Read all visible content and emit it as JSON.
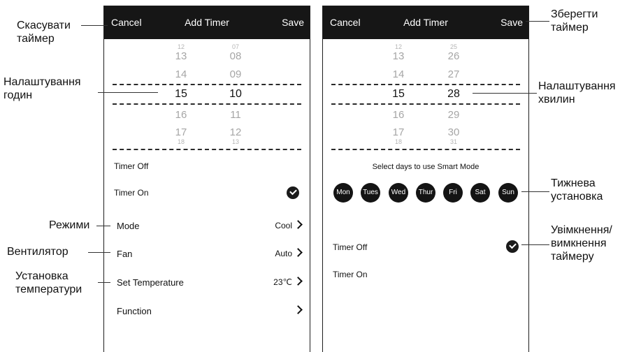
{
  "left_screen": {
    "header": {
      "cancel": "Cancel",
      "title": "Add Timer",
      "save": "Save"
    },
    "hour_col": {
      "tiny_top": "12",
      "above2": "13",
      "above1": "14",
      "selected": "15",
      "below1": "16",
      "below2": "17",
      "tiny_bottom": "18"
    },
    "minute_col": {
      "tiny_top": "07",
      "above2": "08",
      "above1": "09",
      "selected": "10",
      "below1": "11",
      "below2": "12",
      "tiny_bottom": "13"
    },
    "timer_off": "Timer Off",
    "timer_on": "Timer On",
    "settings": [
      {
        "label": "Mode",
        "value": "Cool"
      },
      {
        "label": "Fan",
        "value": "Auto"
      },
      {
        "label": "Set Temperature",
        "value": "23℃"
      },
      {
        "label": "Function",
        "value": ""
      }
    ]
  },
  "right_screen": {
    "header": {
      "cancel": "Cancel",
      "title": "Add Timer",
      "save": "Save"
    },
    "hour_col": {
      "tiny_top": "12",
      "above2": "13",
      "above1": "14",
      "selected": "15",
      "below1": "16",
      "below2": "17",
      "tiny_bottom": "18"
    },
    "minute_col": {
      "tiny_top": "25",
      "above2": "26",
      "above1": "27",
      "selected": "28",
      "below1": "29",
      "below2": "30",
      "tiny_bottom": "31"
    },
    "days_caption": "Select days to use Smart Mode",
    "days": [
      "Mon",
      "Tues",
      "Wed",
      "Thur",
      "Fri",
      "Sat",
      "Sun"
    ],
    "timer_off": "Timer Off",
    "timer_on": "Timer On"
  },
  "annotations": {
    "cancel_timer": "Скасувати таймер",
    "hour_setting": "Налаштування годин",
    "modes": "Режими",
    "fan": "Вентилятор",
    "temp_setting": "Установка температури",
    "save_timer": "Зберегти таймер",
    "minute_setting": "Налаштування хвилин",
    "weekly_setting": "Тижнева установка",
    "timer_toggle": "Увімкнення/ вимкнення таймеру"
  },
  "colors": {
    "header_bg": "#161616",
    "day_bg": "#141414",
    "text": "#111111"
  }
}
